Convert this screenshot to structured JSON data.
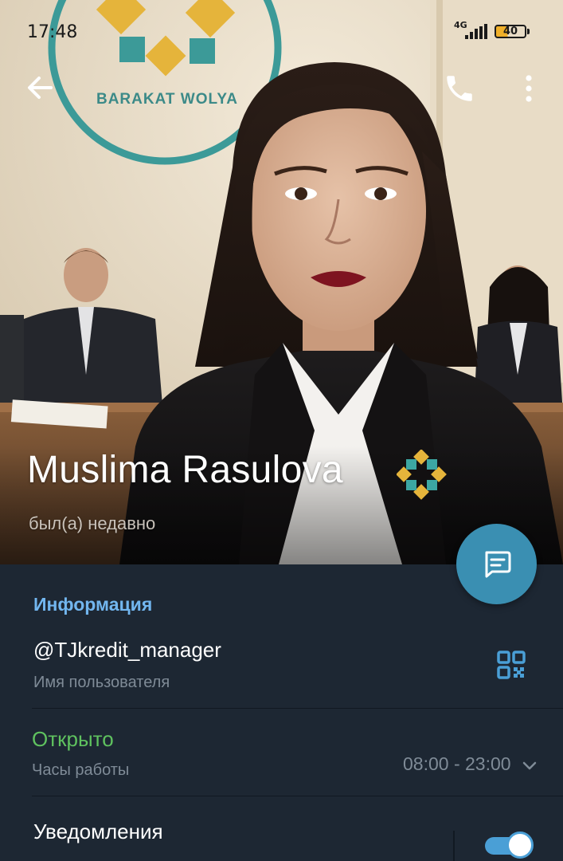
{
  "status_bar": {
    "time": "17:48",
    "network": "4G",
    "battery": "40"
  },
  "header": {
    "back_icon": "arrow-left-icon",
    "call_icon": "phone-icon",
    "menu_icon": "more-vertical-icon"
  },
  "profile": {
    "name": "Muslima Rasulova",
    "badge_icon": "emoji-status-icon",
    "last_seen": "был(а) недавно",
    "fab_icon": "message-icon"
  },
  "info": {
    "section_title": "Информация",
    "username": "@TJkredit_manager",
    "username_caption": "Имя пользователя",
    "qr_icon": "qr-code-icon",
    "hours_status": "Открыто",
    "hours_caption": "Часы работы",
    "hours_value": "08:00 - 23:00",
    "notifications_label": "Уведомления",
    "notifications_enabled": true
  },
  "colors": {
    "background": "#1d2733",
    "accent": "#3a8fb2",
    "section_title": "#72b6ef",
    "open_status": "#5fc25f",
    "secondary_text": "#7f8b97"
  },
  "photo_background": {
    "logo_text": "BARAKAT WOLYA"
  }
}
